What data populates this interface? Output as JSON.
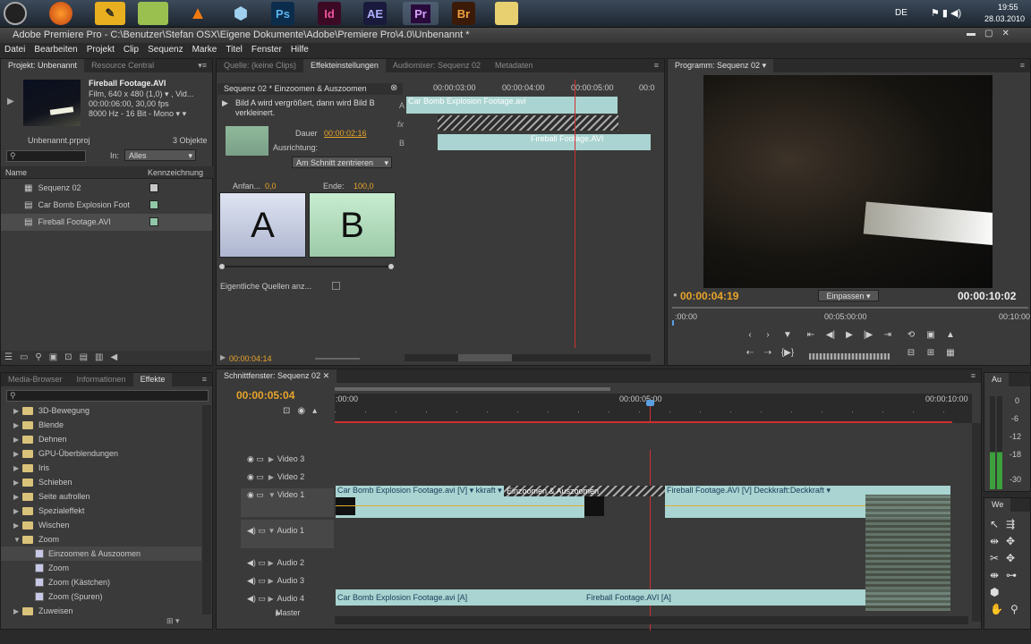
{
  "taskbar": {
    "clock_time": "19:55",
    "clock_date": "28.03.2010",
    "lang": "DE",
    "apps": [
      "Ps",
      "Id",
      "AE",
      "Pr",
      "Br"
    ]
  },
  "window": {
    "title": "Adobe Premiere Pro - C:\\Benutzer\\Stefan OSX\\Eigene Dokumente\\Adobe\\Premiere Pro\\4.0\\Unbenannt *"
  },
  "menu": [
    "Datei",
    "Bearbeiten",
    "Projekt",
    "Clip",
    "Sequenz",
    "Marke",
    "Titel",
    "Fenster",
    "Hilfe"
  ],
  "project": {
    "tabs": [
      "Projekt: Unbenannt",
      "Resource Central"
    ],
    "clip_name": "Fireball Footage.AVI",
    "clip_info": [
      "Film, 640 x 480 (1,0)",
      "00:00:06:00, 30,00 fps",
      "8000 Hz - 16 Bit - Mono"
    ],
    "clip_info_extra": ", Vid...",
    "project_file": "Unbenannt.prproj",
    "count": "3 Objekte",
    "in_label": "In:",
    "in_value": "Alles",
    "col_name": "Name",
    "col_label": "Kennzeichnung",
    "items": [
      "Sequenz 02",
      "Car Bomb Explosion Foot",
      "Fireball Footage.AVI"
    ],
    "item_colors": [
      "#c8c8c8",
      "#8fc7a8",
      "#8fc7a8"
    ]
  },
  "effect_controls": {
    "tabs": [
      "Quelle: (keine Clips)",
      "Effekteinstellungen",
      "Audiomixer: Sequenz 02",
      "Metadaten"
    ],
    "header": "Sequenz 02 * Einzoomen & Auszoomen",
    "desc": "Bild A wird vergrößert, dann wird Bild B verkleinert.",
    "dauer_label": "Dauer",
    "dauer_value": "00:00:02:16",
    "ausrichtung_label": "Ausrichtung:",
    "ausrichtung_value": "Am Schnitt zentrieren",
    "anfang_label": "Anfan...",
    "anfang_value": "0,0",
    "ende_label": "Ende:",
    "ende_value": "100,0",
    "letter_a": "A",
    "letter_b": "B",
    "eigentliche": "Eigentliche Quellen anz...",
    "timecode": "00:00:04:14",
    "ruler": [
      "00:00:03:00",
      "00:00:04:00",
      "00:00:05:00",
      "00:0"
    ],
    "clip_a": "Car Bomb Explosion Footage.avi",
    "clip_b": "Fireball Footage.AVI",
    "abc": [
      "A",
      "fx",
      "B"
    ]
  },
  "program": {
    "tab": "Programm: Sequenz 02",
    "tc_current": "00:00:04:19",
    "fit": "Einpassen",
    "tc_duration": "00:00:10:02",
    "ruler": [
      ":00:00",
      "00:05:00:00",
      "00:10:00"
    ]
  },
  "effects": {
    "tabs": [
      "Media-Browser",
      "Informationen",
      "Effekte"
    ],
    "items": [
      {
        "label": "3D-Bewegung",
        "type": "folder"
      },
      {
        "label": "Blende",
        "type": "folder"
      },
      {
        "label": "Dehnen",
        "type": "folder"
      },
      {
        "label": "GPU-Überblendungen",
        "type": "folder"
      },
      {
        "label": "Iris",
        "type": "folder"
      },
      {
        "label": "Schieben",
        "type": "folder"
      },
      {
        "label": "Seite aufrollen",
        "type": "folder"
      },
      {
        "label": "Spezialeffekt",
        "type": "folder"
      },
      {
        "label": "Wischen",
        "type": "folder"
      },
      {
        "label": "Zoom",
        "type": "folder-open"
      },
      {
        "label": "Einzoomen & Auszoomen",
        "type": "effect"
      },
      {
        "label": "Zoom",
        "type": "effect"
      },
      {
        "label": "Zoom (Kästchen)",
        "type": "effect"
      },
      {
        "label": "Zoom (Spuren)",
        "type": "effect"
      },
      {
        "label": "Zuweisen",
        "type": "folder"
      }
    ]
  },
  "timeline": {
    "tab": "Schnittfenster: Sequenz 02",
    "timecode": "00:00:05:04",
    "ruler": [
      ":00:00",
      "00:00:05:00",
      "00:00:10:00"
    ],
    "tracks": [
      "Video 3",
      "Video 2",
      "Video 1",
      "Audio 1",
      "Audio 2",
      "Audio 3",
      "Audio 4",
      "Master"
    ],
    "v1_clip_a": "Car Bomb Explosion Footage.avi [V]",
    "v1_clip_a_fx": "kkraft",
    "transition": "Einzoomen & Auszoomen",
    "v1_clip_b": "Fireball Footage.AVI [V]",
    "v1_clip_b_fx": "Deckkraft:Deckkraft",
    "a4_clip_a": "Car Bomb Explosion Footage.avi [A]",
    "a4_clip_b": "Fireball Footage.AVI [A]"
  },
  "audio_meter": {
    "tab": "Au",
    "scale": [
      "0",
      "-6",
      "-12",
      "-18",
      "-30"
    ]
  },
  "tools": {
    "tab": "We"
  }
}
